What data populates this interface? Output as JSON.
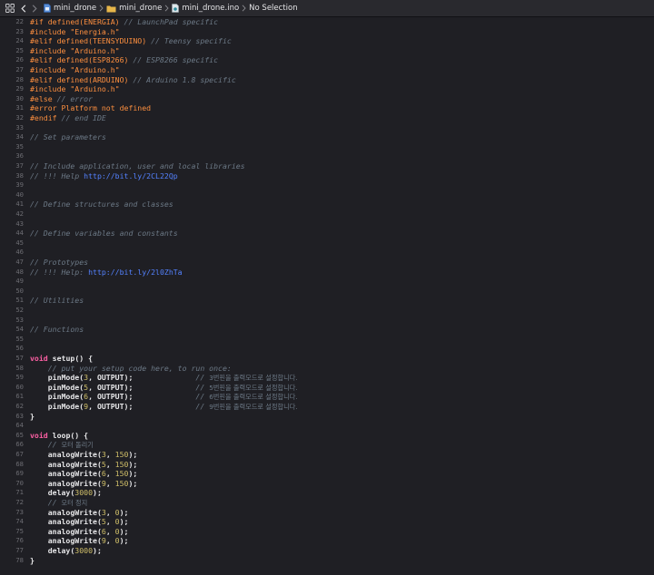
{
  "jumpbar": {
    "project": "mini_drone",
    "folder": "mini_drone",
    "file": "mini_drone.ino",
    "selection": "No Selection"
  },
  "colors": {
    "keyword": "#fc5fa3",
    "preprocessor": "#fd8f3f",
    "comment": "#6c7986",
    "url": "#5482ff",
    "number": "#d0bf69",
    "text": "#e6e6e8",
    "background": "#1f1f24"
  },
  "code_lines": [
    {
      "n": "22",
      "tokens": [
        {
          "t": "#if defined(ENERGIA) ",
          "c": "pp"
        },
        {
          "t": "// LaunchPad specific",
          "c": "cm"
        }
      ]
    },
    {
      "n": "23",
      "tokens": [
        {
          "t": "#include \"Energia.h\"",
          "c": "pp"
        }
      ]
    },
    {
      "n": "24",
      "tokens": [
        {
          "t": "#elif defined(TEENSYDUINO) ",
          "c": "pp"
        },
        {
          "t": "// Teensy specific",
          "c": "cm"
        }
      ]
    },
    {
      "n": "25",
      "tokens": [
        {
          "t": "#include \"Arduino.h\"",
          "c": "pp"
        }
      ]
    },
    {
      "n": "26",
      "tokens": [
        {
          "t": "#elif defined(ESP8266) ",
          "c": "pp"
        },
        {
          "t": "// ESP8266 specific",
          "c": "cm"
        }
      ]
    },
    {
      "n": "27",
      "tokens": [
        {
          "t": "#include \"Arduino.h\"",
          "c": "pp"
        }
      ]
    },
    {
      "n": "28",
      "tokens": [
        {
          "t": "#elif defined(ARDUINO) ",
          "c": "pp"
        },
        {
          "t": "// Arduino 1.8 specific",
          "c": "cm"
        }
      ]
    },
    {
      "n": "29",
      "tokens": [
        {
          "t": "#include \"Arduino.h\"",
          "c": "pp"
        }
      ]
    },
    {
      "n": "30",
      "tokens": [
        {
          "t": "#else ",
          "c": "pp"
        },
        {
          "t": "// error",
          "c": "cm"
        }
      ]
    },
    {
      "n": "31",
      "tokens": [
        {
          "t": "#error Platform not defined",
          "c": "pp"
        }
      ]
    },
    {
      "n": "32",
      "tokens": [
        {
          "t": "#endif ",
          "c": "pp"
        },
        {
          "t": "// end IDE",
          "c": "cm"
        }
      ]
    },
    {
      "n": "33",
      "tokens": []
    },
    {
      "n": "34",
      "tokens": [
        {
          "t": "// Set parameters",
          "c": "cm"
        }
      ]
    },
    {
      "n": "35",
      "tokens": []
    },
    {
      "n": "36",
      "tokens": []
    },
    {
      "n": "37",
      "tokens": [
        {
          "t": "// Include application, user and local libraries",
          "c": "cm"
        }
      ]
    },
    {
      "n": "38",
      "tokens": [
        {
          "t": "// !!! Help ",
          "c": "cm"
        },
        {
          "t": "http://bit.ly/2CL22Qp",
          "c": "url"
        }
      ]
    },
    {
      "n": "39",
      "tokens": []
    },
    {
      "n": "40",
      "tokens": []
    },
    {
      "n": "41",
      "tokens": [
        {
          "t": "// Define structures and classes",
          "c": "cm"
        }
      ]
    },
    {
      "n": "42",
      "tokens": []
    },
    {
      "n": "43",
      "tokens": []
    },
    {
      "n": "44",
      "tokens": [
        {
          "t": "// Define variables and constants",
          "c": "cm"
        }
      ]
    },
    {
      "n": "45",
      "tokens": []
    },
    {
      "n": "46",
      "tokens": []
    },
    {
      "n": "47",
      "tokens": [
        {
          "t": "// Prototypes",
          "c": "cm"
        }
      ]
    },
    {
      "n": "48",
      "tokens": [
        {
          "t": "// !!! Help: ",
          "c": "cm"
        },
        {
          "t": "http://bit.ly/2l0ZhTa",
          "c": "url"
        }
      ]
    },
    {
      "n": "49",
      "tokens": []
    },
    {
      "n": "50",
      "tokens": []
    },
    {
      "n": "51",
      "tokens": [
        {
          "t": "// Utilities",
          "c": "cm"
        }
      ]
    },
    {
      "n": "52",
      "tokens": []
    },
    {
      "n": "53",
      "tokens": []
    },
    {
      "n": "54",
      "tokens": [
        {
          "t": "// Functions",
          "c": "cm"
        }
      ]
    },
    {
      "n": "55",
      "tokens": []
    },
    {
      "n": "56",
      "tokens": []
    },
    {
      "n": "57",
      "tokens": [
        {
          "t": "void ",
          "c": "kw"
        },
        {
          "t": "setup",
          "c": "fn"
        },
        {
          "t": "() {",
          "c": "fn"
        }
      ]
    },
    {
      "n": "58",
      "tokens": [
        {
          "t": "    // put your setup code here, to run once:",
          "c": "cm"
        }
      ]
    },
    {
      "n": "59",
      "tokens": [
        {
          "t": "    pinMode(",
          "c": "fn"
        },
        {
          "t": "3",
          "c": "num"
        },
        {
          "t": ", OUTPUT);              ",
          "c": "fn"
        },
        {
          "t": "// ",
          "c": "cm"
        },
        {
          "t": "3번핀을 출력모드로 설정합니다.",
          "c": "cmk"
        }
      ]
    },
    {
      "n": "60",
      "tokens": [
        {
          "t": "    pinMode(",
          "c": "fn"
        },
        {
          "t": "5",
          "c": "num"
        },
        {
          "t": ", OUTPUT);              ",
          "c": "fn"
        },
        {
          "t": "// ",
          "c": "cm"
        },
        {
          "t": "5번핀을 출력모드로 설정합니다.",
          "c": "cmk"
        }
      ]
    },
    {
      "n": "61",
      "tokens": [
        {
          "t": "    pinMode(",
          "c": "fn"
        },
        {
          "t": "6",
          "c": "num"
        },
        {
          "t": ", OUTPUT);              ",
          "c": "fn"
        },
        {
          "t": "// ",
          "c": "cm"
        },
        {
          "t": "6번핀을 출력모드로 설정합니다.",
          "c": "cmk"
        }
      ]
    },
    {
      "n": "62",
      "tokens": [
        {
          "t": "    pinMode(",
          "c": "fn"
        },
        {
          "t": "9",
          "c": "num"
        },
        {
          "t": ", OUTPUT);              ",
          "c": "fn"
        },
        {
          "t": "// ",
          "c": "cm"
        },
        {
          "t": "9번핀을 출력모드로 설정합니다.",
          "c": "cmk"
        }
      ]
    },
    {
      "n": "63",
      "tokens": [
        {
          "t": "}",
          "c": "fn"
        }
      ]
    },
    {
      "n": "64",
      "tokens": []
    },
    {
      "n": "65",
      "tokens": [
        {
          "t": "void ",
          "c": "kw"
        },
        {
          "t": "loop",
          "c": "fn"
        },
        {
          "t": "() {",
          "c": "fn"
        }
      ]
    },
    {
      "n": "66",
      "tokens": [
        {
          "t": "    // ",
          "c": "cm"
        },
        {
          "t": "모터 돌리기",
          "c": "cmk"
        }
      ]
    },
    {
      "n": "67",
      "tokens": [
        {
          "t": "    analogWrite(",
          "c": "fn"
        },
        {
          "t": "3",
          "c": "num"
        },
        {
          "t": ", ",
          "c": "fn"
        },
        {
          "t": "150",
          "c": "num"
        },
        {
          "t": ");",
          "c": "fn"
        }
      ]
    },
    {
      "n": "68",
      "tokens": [
        {
          "t": "    analogWrite(",
          "c": "fn"
        },
        {
          "t": "5",
          "c": "num"
        },
        {
          "t": ", ",
          "c": "fn"
        },
        {
          "t": "150",
          "c": "num"
        },
        {
          "t": ");",
          "c": "fn"
        }
      ]
    },
    {
      "n": "69",
      "tokens": [
        {
          "t": "    analogWrite(",
          "c": "fn"
        },
        {
          "t": "6",
          "c": "num"
        },
        {
          "t": ", ",
          "c": "fn"
        },
        {
          "t": "150",
          "c": "num"
        },
        {
          "t": ");",
          "c": "fn"
        }
      ]
    },
    {
      "n": "70",
      "tokens": [
        {
          "t": "    analogWrite(",
          "c": "fn"
        },
        {
          "t": "9",
          "c": "num"
        },
        {
          "t": ", ",
          "c": "fn"
        },
        {
          "t": "150",
          "c": "num"
        },
        {
          "t": ");",
          "c": "fn"
        }
      ]
    },
    {
      "n": "71",
      "tokens": [
        {
          "t": "    delay(",
          "c": "fn"
        },
        {
          "t": "3000",
          "c": "num"
        },
        {
          "t": ");",
          "c": "fn"
        }
      ]
    },
    {
      "n": "72",
      "tokens": [
        {
          "t": "    // ",
          "c": "cm"
        },
        {
          "t": "모터 정지",
          "c": "cmk"
        }
      ]
    },
    {
      "n": "73",
      "tokens": [
        {
          "t": "    analogWrite(",
          "c": "fn"
        },
        {
          "t": "3",
          "c": "num"
        },
        {
          "t": ", ",
          "c": "fn"
        },
        {
          "t": "0",
          "c": "num"
        },
        {
          "t": ");",
          "c": "fn"
        }
      ]
    },
    {
      "n": "74",
      "tokens": [
        {
          "t": "    analogWrite(",
          "c": "fn"
        },
        {
          "t": "5",
          "c": "num"
        },
        {
          "t": ", ",
          "c": "fn"
        },
        {
          "t": "0",
          "c": "num"
        },
        {
          "t": ");",
          "c": "fn"
        }
      ]
    },
    {
      "n": "75",
      "tokens": [
        {
          "t": "    analogWrite(",
          "c": "fn"
        },
        {
          "t": "6",
          "c": "num"
        },
        {
          "t": ", ",
          "c": "fn"
        },
        {
          "t": "0",
          "c": "num"
        },
        {
          "t": ");",
          "c": "fn"
        }
      ]
    },
    {
      "n": "76",
      "tokens": [
        {
          "t": "    analogWrite(",
          "c": "fn"
        },
        {
          "t": "9",
          "c": "num"
        },
        {
          "t": ", ",
          "c": "fn"
        },
        {
          "t": "0",
          "c": "num"
        },
        {
          "t": ");",
          "c": "fn"
        }
      ]
    },
    {
      "n": "77",
      "tokens": [
        {
          "t": "    delay(",
          "c": "fn"
        },
        {
          "t": "3000",
          "c": "num"
        },
        {
          "t": ");",
          "c": "fn"
        }
      ]
    },
    {
      "n": "78",
      "tokens": [
        {
          "t": "}",
          "c": "fn"
        }
      ]
    }
  ]
}
